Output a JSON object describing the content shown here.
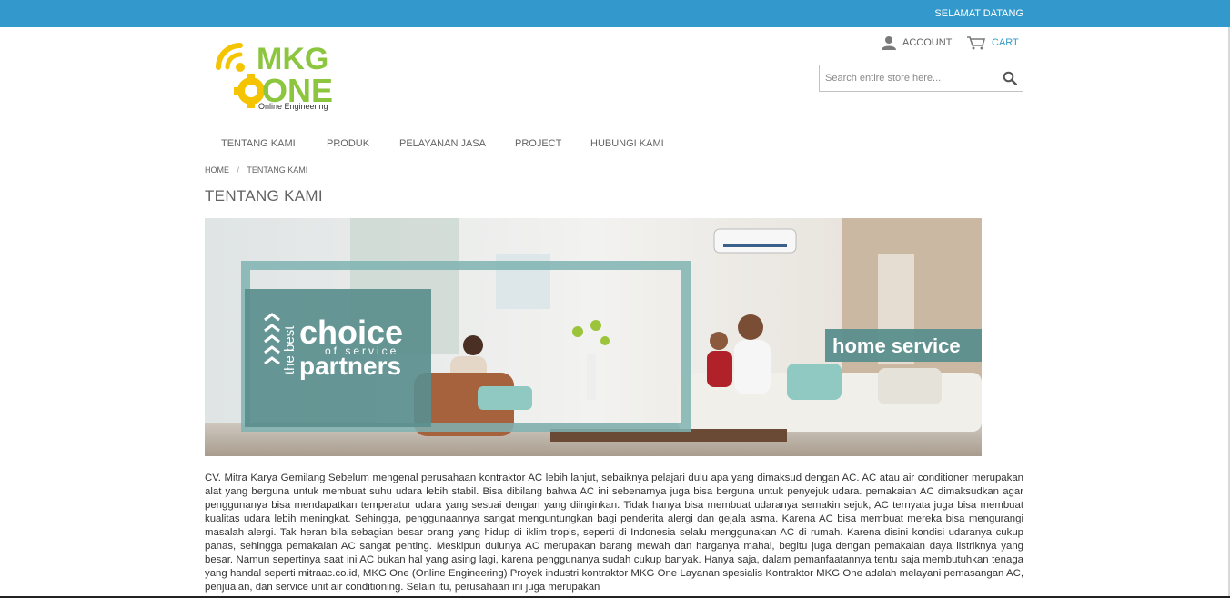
{
  "topbar": {
    "welcome": "SELAMAT DATANG"
  },
  "logo": {
    "subtitle": "Online Engineering",
    "letters_top": "MKG",
    "letters_bottom": "ONE"
  },
  "header_links": {
    "account": "ACCOUNT",
    "cart": "CART"
  },
  "search": {
    "placeholder": "Search entire store here..."
  },
  "nav": {
    "items": [
      "TENTANG KAMI",
      "PRODUK",
      "PELAYANAN JASA",
      "PROJECT",
      "HUBUNGI KAMI"
    ]
  },
  "breadcrumb": {
    "home": "HOME",
    "separator": "/",
    "current": "TENTANG KAMI"
  },
  "page": {
    "title": "TENTANG KAMI"
  },
  "banner": {
    "vertical_text": "the best",
    "choice": "choice",
    "of_service": "of service",
    "partners": "partners",
    "home_service": "home service"
  },
  "content": {
    "paragraph": "CV. Mitra Karya Gemilang Sebelum mengenal perusahaan kontraktor AC lebih lanjut, sebaiknya pelajari dulu apa yang dimaksud dengan AC. AC atau air conditioner merupakan alat yang berguna untuk membuat suhu udara lebih stabil. Bisa dibilang bahwa AC ini sebenarnya juga bisa berguna untuk penyejuk udara. pemakaian AC dimaksudkan agar penggunanya bisa mendapatkan temperatur udara yang sesuai dengan yang diinginkan. Tidak hanya bisa membuat udaranya semakin sejuk, AC ternyata juga bisa membuat kualitas udara lebih meningkat. Sehingga, penggunaannya sangat menguntungkan bagi penderita alergi dan gejala asma. Karena AC bisa membuat mereka bisa mengurangi masalah alergi. Tak heran bila sebagian besar orang yang hidup di iklim tropis, seperti di Indonesia selalu menggunakan AC di rumah. Karena disini kondisi udaranya cukup panas, sehingga pemakaian AC sangat penting. Meskipun dulunya AC merupakan barang mewah dan harganya mahal, begitu juga dengan pemakaian daya listriknya yang besar. Namun sepertinya saat ini AC bukan hal yang asing lagi, karena penggunanya sudah cukup banyak. Hanya saja, dalam pemanfaatannya tentu saja membutuhkan tenaga yang handal seperti mitraac.co.id, MKG One (Online Engineering) Proyek industri kontraktor MKG One Layanan spesialis Kontraktor MKG One adalah melayani pemasangan AC, penjualan, dan service unit air conditioning. Selain itu, perusahaan ini juga merupakan"
  },
  "colors": {
    "topbar": "#3399cc",
    "logo_green": "#8cc63f",
    "logo_yellow": "#f5c400",
    "teal": "#6fa5a5"
  }
}
